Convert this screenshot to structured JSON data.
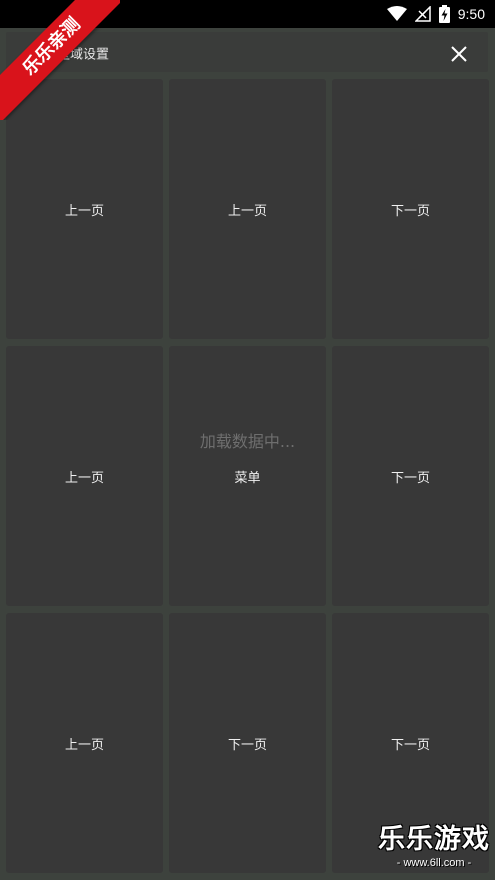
{
  "status_bar": {
    "time": "9:50"
  },
  "header": {
    "title": "自定义点击区域设置",
    "title_visible": "击区域设置"
  },
  "grid": {
    "cells": [
      {
        "label": "上一页"
      },
      {
        "label": "上一页"
      },
      {
        "label": "下一页"
      },
      {
        "label": "上一页"
      },
      {
        "label": "菜单"
      },
      {
        "label": "下一页"
      },
      {
        "label": "上一页"
      },
      {
        "label": "下一页"
      },
      {
        "label": "下一页"
      }
    ]
  },
  "loading_text": "加载数据中...",
  "watermark": {
    "ribbon": "乐乐亲测",
    "brand": "乐乐游戏",
    "url": "- www.6ll.com -"
  },
  "colors": {
    "background": "#3d423d",
    "cell": "#383838",
    "ribbon": "#d9131b"
  }
}
